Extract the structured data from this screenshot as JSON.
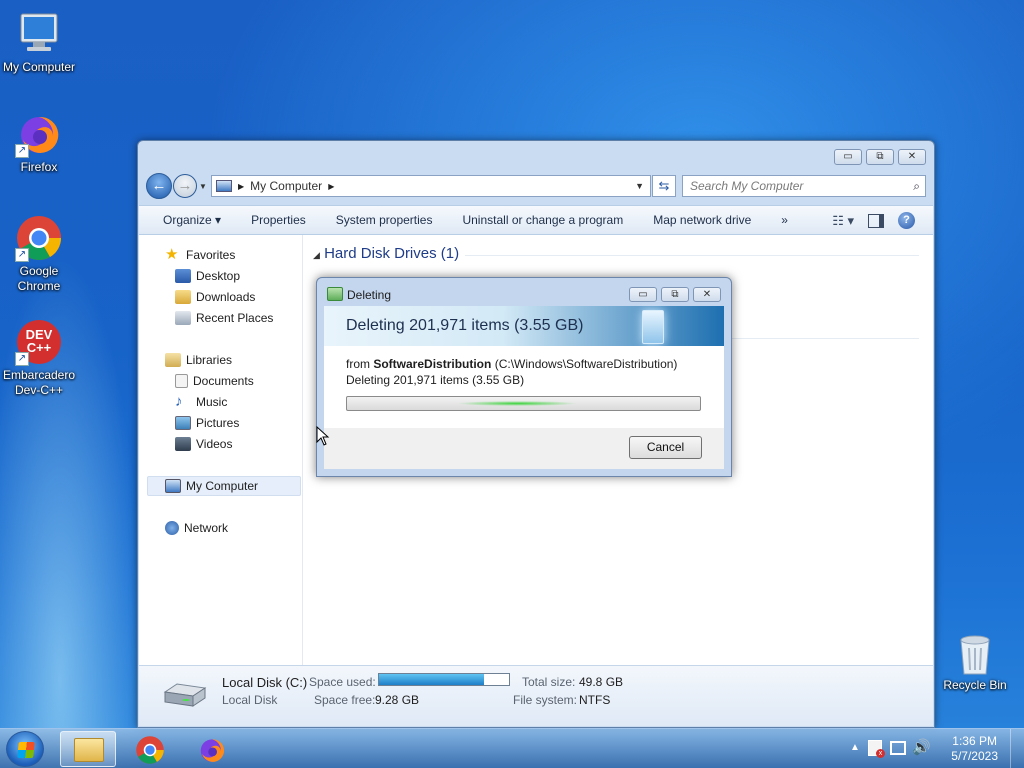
{
  "desktop": {
    "icons": [
      {
        "label": "My Computer"
      },
      {
        "label": "Firefox"
      },
      {
        "label": "Google Chrome"
      },
      {
        "label": "Embarcadero Dev-C++",
        "badge": "DEV C++"
      },
      {
        "label": "Recycle Bin"
      }
    ]
  },
  "explorer": {
    "window_controls": {
      "minimize": "▭",
      "restore": "⧉",
      "close": "✕"
    },
    "address": {
      "location": "My Computer"
    },
    "search": {
      "placeholder": "Search My Computer"
    },
    "commands": [
      "Organize",
      "Properties",
      "System properties",
      "Uninstall or change a program",
      "Map network drive",
      "»"
    ],
    "nav": {
      "favorites": "Favorites",
      "desktop": "Desktop",
      "downloads": "Downloads",
      "recent_places": "Recent Places",
      "libraries": "Libraries",
      "documents": "Documents",
      "music": "Music",
      "pictures": "Pictures",
      "videos": "Videos",
      "my_computer": "My Computer",
      "network": "Network"
    },
    "group_header": "Hard Disk Drives (1)",
    "details": {
      "drive_name": "Local Disk (C:)",
      "drive_type": "Local Disk",
      "space_used_label": "Space used:",
      "space_used_fraction": 0.81,
      "space_free_label": "Space free:",
      "space_free_value": "9.28 GB",
      "total_size_label": "Total size:",
      "total_size_value": "49.8 GB",
      "filesystem_label": "File system:",
      "filesystem_value": "NTFS"
    }
  },
  "dialog": {
    "title": "Deleting",
    "header": "Deleting 201,971 items (3.55 GB)",
    "from_prefix": "from ",
    "from_name": "SoftwareDistribution",
    "from_path": " (C:\\Windows\\SoftwareDistribution)",
    "status": "Deleting 201,971 items (3.55 GB)",
    "cancel_label": "Cancel"
  },
  "taskbar": {
    "time": "1:36 PM",
    "date": "5/7/2023"
  },
  "colors": {
    "desktop_blue": "#1a5fc4",
    "accent": "#1e3c87",
    "progress_green": "#3cd43c"
  }
}
